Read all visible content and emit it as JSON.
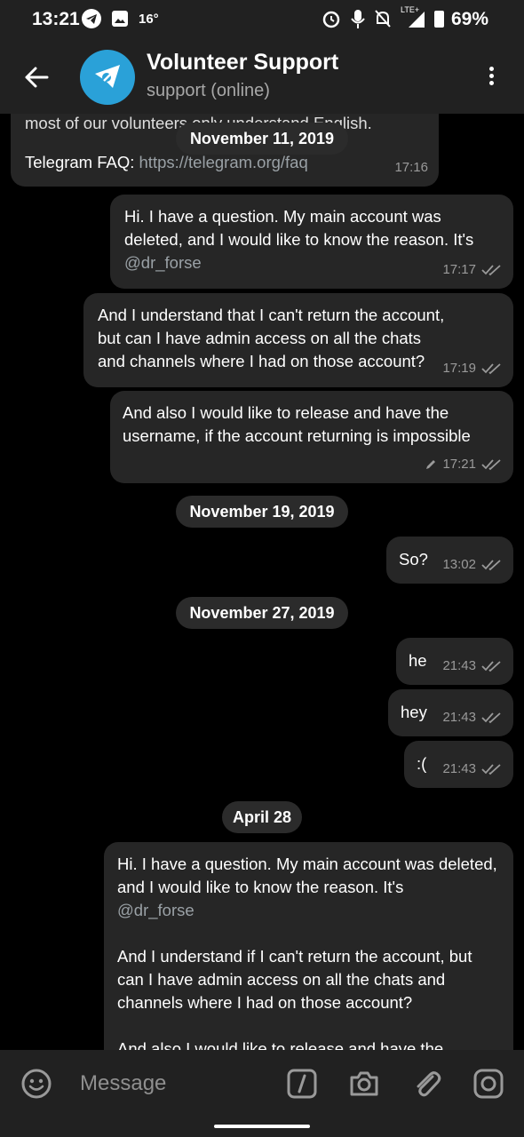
{
  "status_bar": {
    "time": "13:21",
    "temperature": "16°",
    "network": "LTE+",
    "battery": "69%"
  },
  "header": {
    "title": "Volunteer Support",
    "subtitle": "support (online)"
  },
  "messages": [
    {
      "partial_text": "most of our volunteers only understand English.",
      "text": "Telegram FAQ: ",
      "link": "https://telegram.org/faq",
      "time": "17:16",
      "outgoing": false
    },
    {
      "text": "Hi. I have a question. My main account was deleted, and I would like to know the reason. It's",
      "link": "@dr_forse",
      "time": "17:17",
      "outgoing": true
    },
    {
      "text": "And I understand that I can't return the account, but can I have admin access on all the chats and channels where I had on those account?",
      "time": "17:19",
      "outgoing": true
    },
    {
      "text": "And also I would like to release and have the username, if the account returning is impossible",
      "time": "17:21",
      "edited": true,
      "outgoing": true
    },
    {
      "text": "So?",
      "time": "13:02",
      "outgoing": true
    },
    {
      "text": "he",
      "time": "21:43",
      "outgoing": true
    },
    {
      "text": "hey",
      "time": "21:43",
      "outgoing": true
    },
    {
      "text": ":(",
      "time": "21:43",
      "outgoing": true
    },
    {
      "text": "Hi. I have a question. My main account was deleted, and I would like to know the reason. It's",
      "link": "@dr_forse",
      "text2": "And I understand if I can't return the account, but can I have admin access on all the chats and channels where I had on those account?",
      "text3": "And also I would like to release and have the",
      "outgoing": true
    }
  ],
  "dates": [
    "November 11, 2019",
    "November 19, 2019",
    "November 27, 2019",
    "April 28"
  ],
  "input": {
    "placeholder": "Message"
  },
  "colors": {
    "bar": "#212121",
    "bubble": "#262626",
    "avatar": "#2aa1d8",
    "link": "#9aa1a6"
  },
  "icons": [
    "back-arrow-icon",
    "menu-icon",
    "emoji-icon",
    "bot-command-icon",
    "camera-icon",
    "attach-icon",
    "instagram-icon"
  ]
}
